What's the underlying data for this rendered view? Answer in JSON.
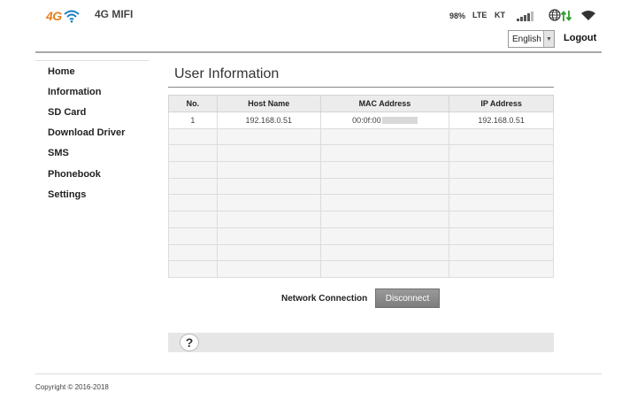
{
  "header": {
    "logo_text": "4G",
    "brand": "4G MIFI",
    "battery": "98%",
    "network_type": "LTE",
    "carrier": "KT",
    "language": "English",
    "logout_label": "Logout",
    "colors": {
      "logo": "#e8801e",
      "wifi_logo": "#1a7fc4",
      "data_arrows": "#2ca02c"
    }
  },
  "sidebar": {
    "items": [
      {
        "label": "Home"
      },
      {
        "label": "Information"
      },
      {
        "label": "SD Card"
      },
      {
        "label": "Download Driver"
      },
      {
        "label": "SMS"
      },
      {
        "label": "Phonebook"
      },
      {
        "label": "Settings"
      }
    ]
  },
  "main": {
    "title": "User Information",
    "table": {
      "headers": [
        "No.",
        "Host Name",
        "MAC Address",
        "IP Address"
      ],
      "rows": [
        [
          "1",
          "192.168.0.51",
          "00:0f:00",
          "192.168.0.51"
        ]
      ]
    },
    "network_connection_label": "Network Connection",
    "disconnect_label": "Disconnect",
    "help_symbol": "?"
  },
  "footer": {
    "copyright": "Copyright © 2016-2018"
  }
}
